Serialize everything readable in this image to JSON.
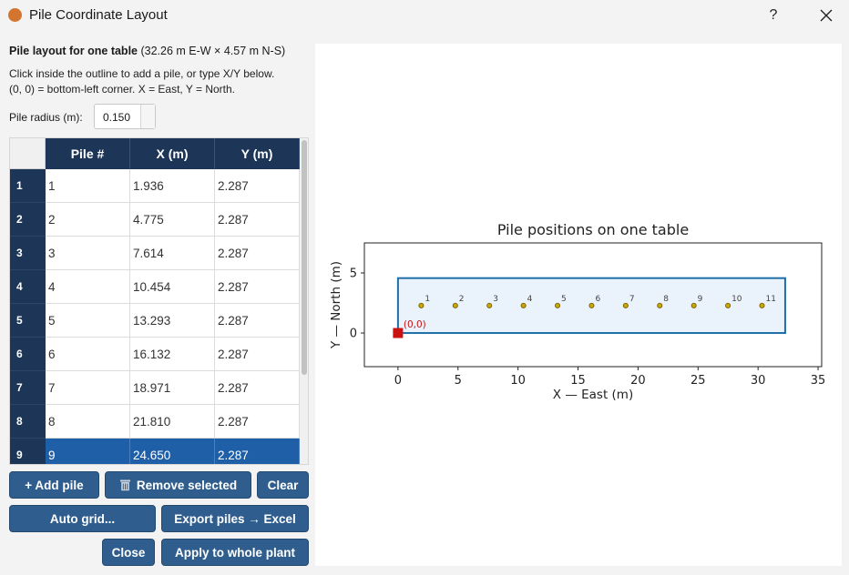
{
  "window": {
    "title": "Pile Coordinate Layout",
    "help_label": "?",
    "app_icon_color": "#d3752f"
  },
  "panel": {
    "title_bold": "Pile layout for one table",
    "title_dims": "(32.26 m E-W × 4.57 m N-S)",
    "instruction_line1": "Click inside the outline to add a pile, or type X/Y below.",
    "instruction_line2": "(0, 0) = bottom-left corner.  X = East, Y = North.",
    "radius_label": "Pile radius (m):",
    "radius_value": "0.150"
  },
  "table": {
    "columns": [
      "Pile #",
      "X (m)",
      "Y (m)"
    ],
    "rows": [
      {
        "index": "1",
        "pile": "1",
        "x": "1.936",
        "y": "2.287"
      },
      {
        "index": "2",
        "pile": "2",
        "x": "4.775",
        "y": "2.287"
      },
      {
        "index": "3",
        "pile": "3",
        "x": "7.614",
        "y": "2.287"
      },
      {
        "index": "4",
        "pile": "4",
        "x": "10.454",
        "y": "2.287"
      },
      {
        "index": "5",
        "pile": "5",
        "x": "13.293",
        "y": "2.287"
      },
      {
        "index": "6",
        "pile": "6",
        "x": "16.132",
        "y": "2.287"
      },
      {
        "index": "7",
        "pile": "7",
        "x": "18.971",
        "y": "2.287"
      },
      {
        "index": "8",
        "pile": "8",
        "x": "21.810",
        "y": "2.287"
      },
      {
        "index": "9",
        "pile": "9",
        "x": "24.650",
        "y": "2.287"
      }
    ],
    "selected_row": "9",
    "header_color": "#1d3557",
    "selected_color": "#1f5fa8"
  },
  "buttons": {
    "add": "+ Add pile",
    "remove": "Remove selected",
    "clear": "Clear",
    "auto_grid": "Auto grid...",
    "export": "Export piles → Excel",
    "close": "Close",
    "apply": "Apply to whole plant",
    "color": "#2f5e8e"
  },
  "chart_data": {
    "type": "scatter",
    "title": "Pile positions on one table",
    "xlabel": "X — East (m)",
    "ylabel": "Y — North (m)",
    "xlim": [
      -2.8,
      35.3
    ],
    "ylim": [
      -2.8,
      7.5
    ],
    "xticks": [
      0,
      5,
      10,
      15,
      20,
      25,
      30,
      35
    ],
    "yticks": [
      0,
      5
    ],
    "table_outline": {
      "x0": 0,
      "y0": 0,
      "width": 32.26,
      "height": 4.57,
      "color": "#1f6fa8",
      "fill": "#eaf2fb"
    },
    "origin_label": "(0,0)",
    "origin_color": "#cc1111",
    "pile_color": "#c9a600",
    "piles": [
      {
        "label": "1",
        "x": 1.936,
        "y": 2.287
      },
      {
        "label": "2",
        "x": 4.775,
        "y": 2.287
      },
      {
        "label": "3",
        "x": 7.614,
        "y": 2.287
      },
      {
        "label": "4",
        "x": 10.454,
        "y": 2.287
      },
      {
        "label": "5",
        "x": 13.293,
        "y": 2.287
      },
      {
        "label": "6",
        "x": 16.132,
        "y": 2.287
      },
      {
        "label": "7",
        "x": 18.971,
        "y": 2.287
      },
      {
        "label": "8",
        "x": 21.81,
        "y": 2.287
      },
      {
        "label": "9",
        "x": 24.65,
        "y": 2.287
      },
      {
        "label": "10",
        "x": 27.489,
        "y": 2.287
      },
      {
        "label": "11",
        "x": 30.328,
        "y": 2.287
      }
    ],
    "grid": false
  }
}
